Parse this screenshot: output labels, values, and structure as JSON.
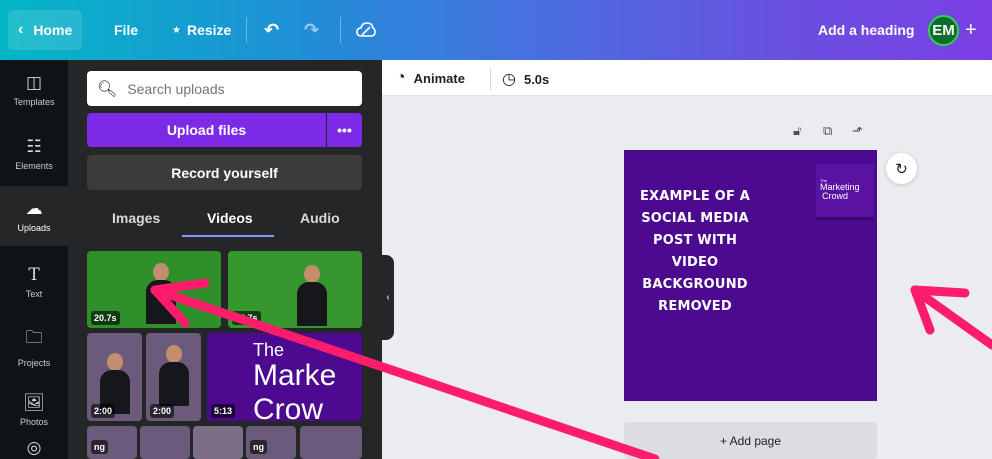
{
  "topbar": {
    "home_label": "Home",
    "file_label": "File",
    "resize_label": "Resize",
    "heading_label": "Add a heading",
    "avatar_initials": "EM",
    "plus_label": "+"
  },
  "rail": {
    "items": [
      {
        "label": "Templates",
        "icon": "templates-icon"
      },
      {
        "label": "Elements",
        "icon": "elements-icon"
      },
      {
        "label": "Uploads",
        "icon": "cloud-upload-icon"
      },
      {
        "label": "Text",
        "icon": "text-icon"
      },
      {
        "label": "Projects",
        "icon": "folder-icon"
      },
      {
        "label": "Photos",
        "icon": "photo-icon"
      }
    ]
  },
  "panel": {
    "search_placeholder": "Search uploads",
    "upload_label": "Upload files",
    "more_label": "•••",
    "record_label": "Record yourself",
    "tabs": [
      "Images",
      "Videos",
      "Audio"
    ],
    "active_tab": "Videos",
    "videos": [
      {
        "duration": "20.7s"
      },
      {
        "duration": "24.7s"
      },
      {
        "duration": "2:00"
      },
      {
        "duration": "2:00"
      },
      {
        "duration": "5:13"
      }
    ],
    "thumb_text": {
      "the": "The",
      "marke": "Marke",
      "crow": "Crow"
    },
    "partial_labels": [
      "ng",
      "ng"
    ]
  },
  "editor": {
    "animate_label": "Animate",
    "duration_label": "5.0s",
    "design_text": "EXAMPLE OF A SOCIAL MEDIA POST WITH VIDEO BACKGROUND REMOVED",
    "logo": {
      "small": "The",
      "line1": "Marketing",
      "line2": "Crowd"
    },
    "add_page_label": "+ Add page"
  },
  "colors": {
    "brand_purple": "#7d2ae8",
    "design_bg": "#4b0a8f",
    "arrow": "#ff1c6b"
  }
}
